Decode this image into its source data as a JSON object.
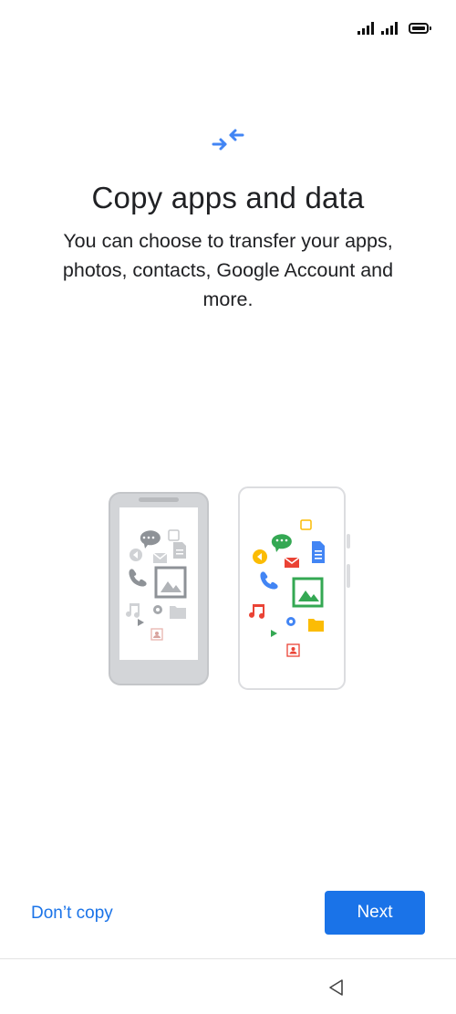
{
  "status_bar": {
    "signal_icon": "cellular-signal-icon",
    "battery_icon": "battery-icon"
  },
  "header": {
    "icon": "transfer-arrows-icon",
    "title": "Copy apps and data",
    "subtitle": "You can choose to transfer your apps, photos, contacts, Google Account and more."
  },
  "illustration": {
    "old_phone_icons": [
      "chat-icon",
      "calendar-icon",
      "document-icon",
      "mail-icon",
      "phone-icon",
      "photo-icon",
      "music-icon",
      "settings-icon",
      "folder-icon",
      "play-icon",
      "contact-icon",
      "arrow-icon"
    ],
    "new_phone_icons": [
      "chat-icon",
      "calendar-icon",
      "document-icon",
      "mail-icon",
      "phone-icon",
      "photo-icon",
      "music-icon",
      "settings-icon",
      "folder-icon",
      "play-icon",
      "contact-icon",
      "arrow-icon"
    ]
  },
  "footer": {
    "dont_copy_label": "Don’t copy",
    "next_label": "Next"
  },
  "nav": {
    "back_icon": "back-triangle-icon"
  },
  "colors": {
    "accent": "#1a73e8",
    "google_green": "#34a853",
    "google_red": "#ea4335",
    "google_yellow": "#fbbc04",
    "old_phone_gray": "#cfd1d4"
  }
}
